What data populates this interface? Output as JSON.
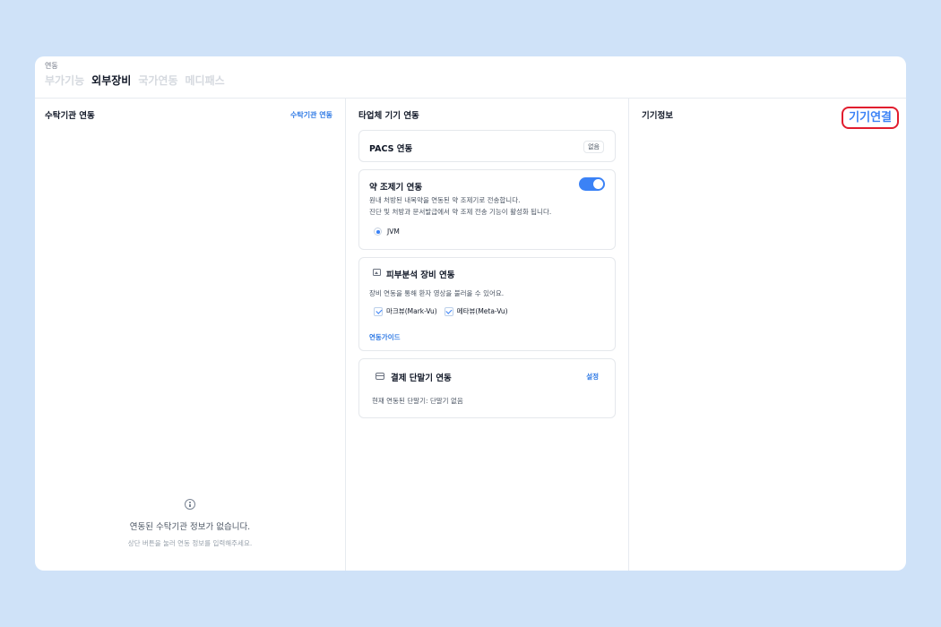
{
  "header": {
    "breadcrumb": "연동",
    "tabs": [
      "부가기능",
      "외부장비",
      "국가연동",
      "메디패스"
    ],
    "active_tab": "외부장비"
  },
  "left_panel": {
    "title": "수탁기관 연동",
    "action_label": "수탁기관 연동",
    "empty_title": "연동된 수탁기관 정보가 없습니다.",
    "empty_subtitle": "상단 버튼을 눌러 연동 정보를 입력해주세요.",
    "empty_icon": "info-icon"
  },
  "middle_panel": {
    "title": "타업체 기기 연동",
    "pacs": {
      "title": "PACS 연동",
      "badge": "없음"
    },
    "dispenser": {
      "title": "약 조제기 연동",
      "toggle_on": true,
      "desc_line1": "원내 처방된 내복약을 연동된 약 조제기로 전송합니다.",
      "desc_line2": "진단 및 처방과 문서발급에서 약 조제 전송 기능이 활성화 됩니다.",
      "option": "JVM"
    },
    "skin": {
      "title": "피부분석 장비 연동",
      "icon": "image-icon",
      "desc": "장비 연동을 통해 환자 영상을 불러올 수 있어요.",
      "options": [
        "마크뷰(Mark-Vu)",
        "메타뷰(Meta-Vu)"
      ],
      "guide_label": "연동가이드"
    },
    "payment": {
      "title": "결제 단말기 연동",
      "icon": "card-icon",
      "action_label": "설정",
      "status": "현재 연동된 단말기: 단말기 없음"
    }
  },
  "right_panel": {
    "title": "기기정보",
    "connect_label": "기기연결",
    "highlight_color": "#e11d2e"
  },
  "colors": {
    "background": "#cfe2f8",
    "accent": "#3b82f6"
  }
}
